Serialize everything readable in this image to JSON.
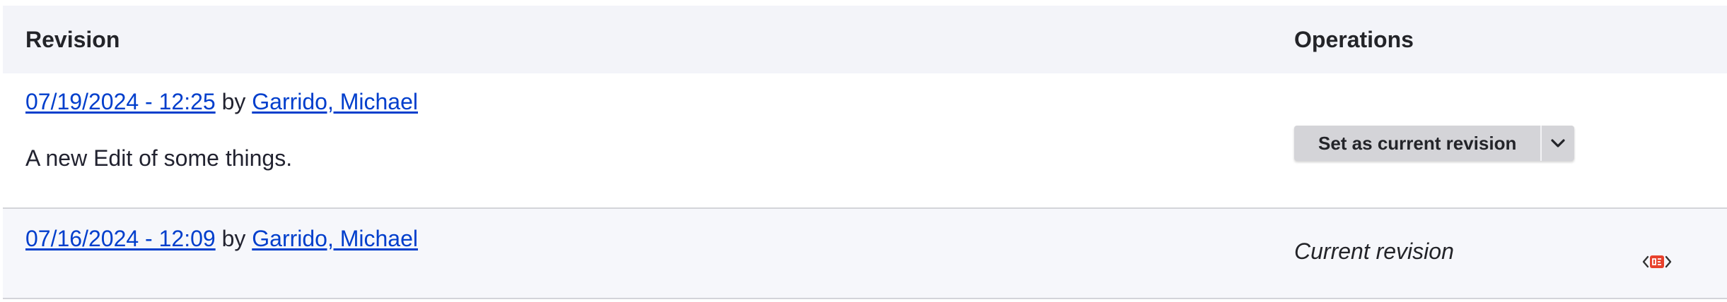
{
  "table": {
    "headers": {
      "revision": "Revision",
      "operations": "Operations"
    },
    "rows": [
      {
        "date": "07/19/2024 - 12:25",
        "by": "by",
        "author": "Garrido, Michael",
        "message": "A new Edit of some things.",
        "operation": {
          "button_label": "Set as current revision",
          "toggle_icon": "chevron-down-icon"
        }
      },
      {
        "date": "07/16/2024 - 12:09",
        "by": "by",
        "author": "Garrido, Michael",
        "status": "Current revision"
      }
    ]
  },
  "colors": {
    "link": "#003ecc",
    "header_bg": "#f3f4f9",
    "button_bg": "#d4d4d8",
    "badge_red": "#e8412c"
  },
  "icons": {
    "badge": "code-badge-icon"
  }
}
